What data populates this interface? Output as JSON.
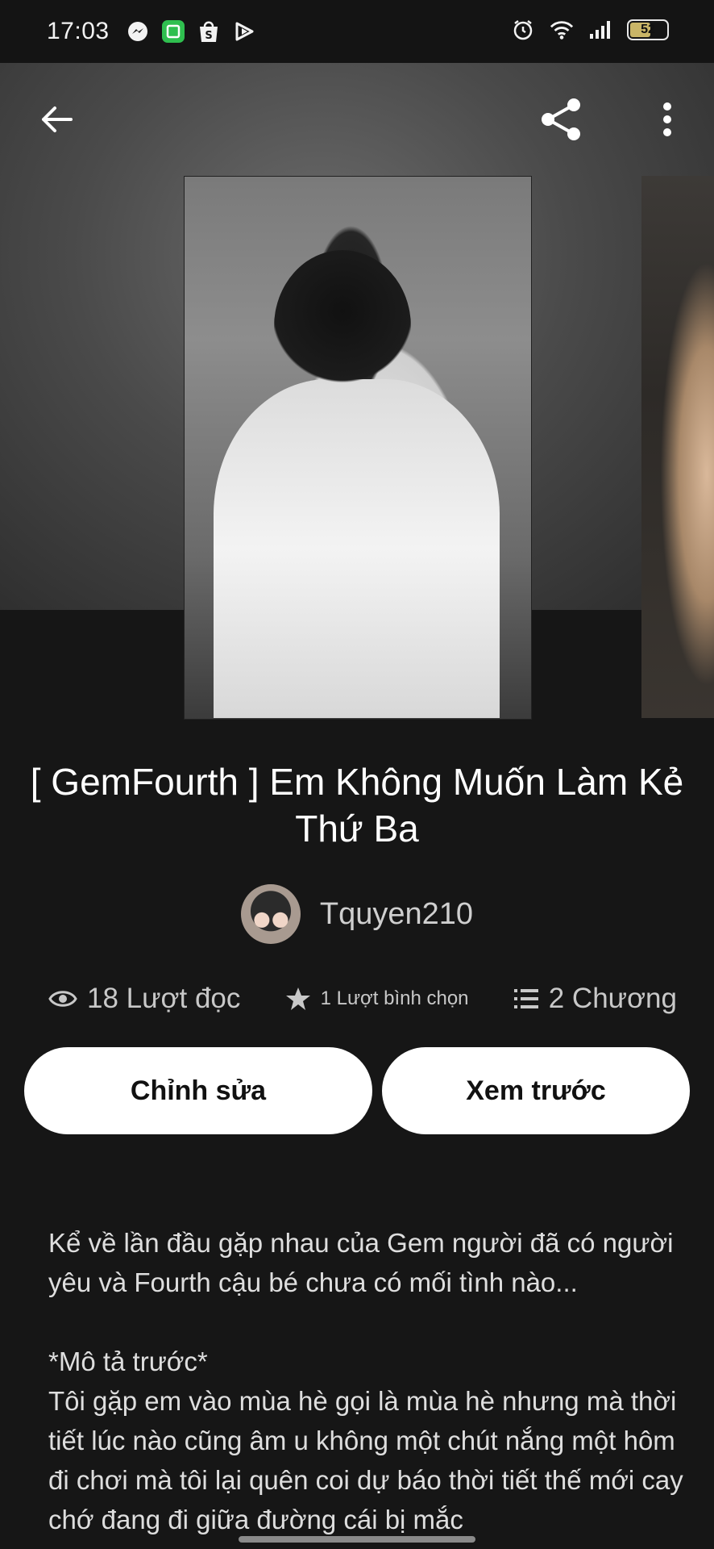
{
  "status_bar": {
    "time": "17:03",
    "battery": "52",
    "left_icons": [
      "messenger-icon",
      "app-green-icon",
      "shopee-icon",
      "play-icon"
    ],
    "right_icons": [
      "alarm-icon",
      "wifi-icon",
      "signal-icon",
      "battery-icon"
    ]
  },
  "nav": {
    "back_icon": "arrow-left-icon",
    "share_icon": "share-icon",
    "more_icon": "more-vert-icon"
  },
  "story": {
    "title": "[ GemFourth ] Em Không Muốn Làm Kẻ Thứ Ba",
    "author": "Tquyen210",
    "stats": {
      "reads": "18 Lượt đọc",
      "votes": "1 Lượt bình chọn",
      "chapters": "2 Chương"
    }
  },
  "buttons": {
    "edit": "Chỉnh sửa",
    "preview": "Xem trước"
  },
  "description": "Kể về lần đầu gặp nhau của Gem người đã có người yêu và Fourth cậu bé chưa có mối tình nào...\n\n*Mô tả trước*\nTôi gặp em vào mùa hè gọi là mùa hè nhưng mà thời tiết lúc nào cũng âm u không một chút nắng một hôm đi chơi mà tôi lại quên coi dự báo thời tiết thế mới cay chớ đang đi giữa đường cái bị mắc",
  "colors": {
    "background": "#161616",
    "button_bg": "#ffffff",
    "battery_fill": "#c9b567"
  }
}
